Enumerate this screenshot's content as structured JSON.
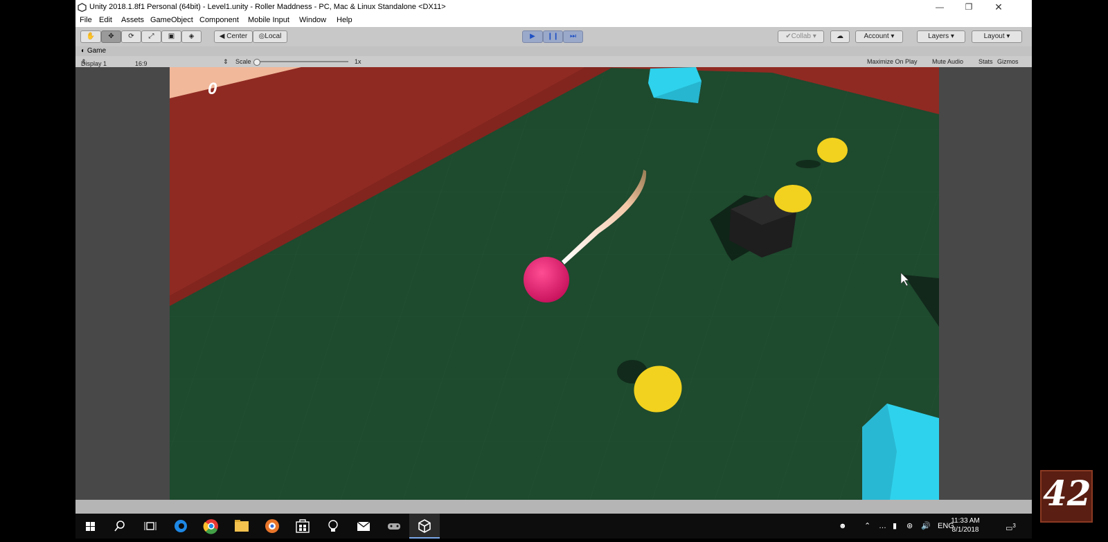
{
  "window": {
    "title": "Unity 2018.1.8f1 Personal (64bit) - Level1.unity - Roller Maddness - PC, Mac & Linux Standalone <DX11>"
  },
  "menu": [
    "File",
    "Edit",
    "Assets",
    "GameObject",
    "Component",
    "Mobile Input",
    "Window",
    "Help"
  ],
  "toolbar": {
    "pivot": "Center",
    "space": "Local",
    "collab": "Collab",
    "account": "Account",
    "layers": "Layers",
    "layout": "Layout"
  },
  "game_tab": {
    "label": "Game"
  },
  "game_toolbar": {
    "display": "Display 1",
    "aspect": "16:9",
    "scale_label": "Scale",
    "scale_value": "1x",
    "scale_level": 0.0,
    "maximize": "Maximize On Play",
    "mute": "Mute Audio",
    "stats": "Stats",
    "gizmos": "Gizmos"
  },
  "game": {
    "score": "0"
  },
  "taskbar": {
    "language": "ENG",
    "time": "11:33 AM",
    "date": "8/1/2018",
    "notifications": "3"
  },
  "watermark": {
    "text": "42"
  },
  "colors": {
    "floor": "#1e4a2e",
    "wall": "#8f2a22",
    "ball": "#e0186a",
    "coin": "#f2d21e",
    "cube": "#2fd2ec"
  }
}
